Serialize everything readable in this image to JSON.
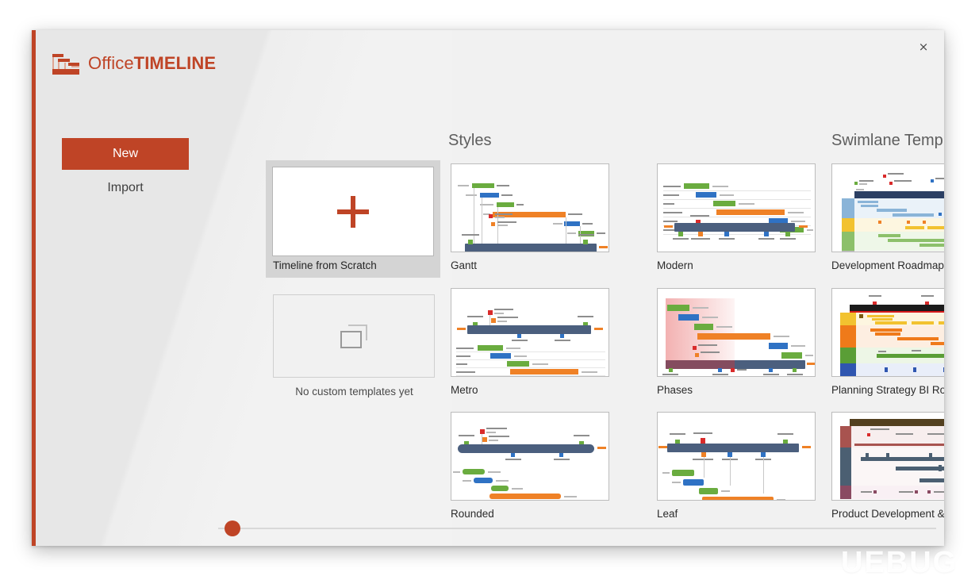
{
  "app": {
    "brand_office": "Office",
    "brand_timeline": "TIMELINE",
    "close_label": "×",
    "accent_color": "#bf4426"
  },
  "nav": {
    "new_label": "New",
    "import_label": "Import"
  },
  "cards": {
    "scratch_label": "Timeline from Scratch",
    "custom_empty_label": "No custom templates yet"
  },
  "sections": {
    "styles_title": "Styles",
    "swimlane_title": "Swimlane Temp"
  },
  "styles": [
    {
      "label": "Gantt"
    },
    {
      "label": "Modern"
    },
    {
      "label": "Metro"
    },
    {
      "label": "Phases"
    },
    {
      "label": "Rounded"
    },
    {
      "label": "Leaf"
    }
  ],
  "swimlanes": [
    {
      "label": "Development Roadmap"
    },
    {
      "label": "Planning Strategy BI Ro"
    },
    {
      "label": "Product Development &"
    }
  ],
  "slider": {
    "position_percent": 1
  },
  "watermark": {
    "text": "UEBUG"
  }
}
